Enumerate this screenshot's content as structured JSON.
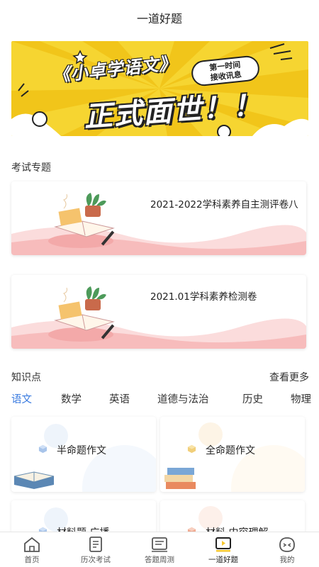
{
  "header": {
    "title": "一道好题"
  },
  "banner": {
    "title_line1": "《小卓学语文》",
    "bubble_line1": "第一时间",
    "bubble_line2": "接收讯息",
    "title_line2": "正式面世！！"
  },
  "exam_section": {
    "title": "考试专题",
    "cards": [
      {
        "title": "2021-2022学科素养自主测评卷八"
      },
      {
        "title": "2021.01学科素养检测卷"
      }
    ]
  },
  "knowledge_section": {
    "title": "知识点",
    "more_label": "查看更多",
    "tabs": [
      "语文",
      "数学",
      "英语",
      "道德与法治",
      "历史",
      "物理"
    ],
    "active_tab": "语文",
    "cards": [
      {
        "label": "半命题作文"
      },
      {
        "label": "全命题作文"
      },
      {
        "label": "材料题 广播"
      },
      {
        "label": "材料 内容理解"
      }
    ]
  },
  "colors": {
    "accent": "#3a7be0",
    "banner_yellow": "#f6d531"
  },
  "tabbar": {
    "items": [
      {
        "label": "首页",
        "icon": "home-icon"
      },
      {
        "label": "历次考试",
        "icon": "exam-history-icon"
      },
      {
        "label": "答题周测",
        "icon": "weekly-test-icon"
      },
      {
        "label": "一道好题",
        "icon": "video-icon"
      },
      {
        "label": "我的",
        "icon": "profile-icon"
      }
    ],
    "active": "一道好题"
  }
}
